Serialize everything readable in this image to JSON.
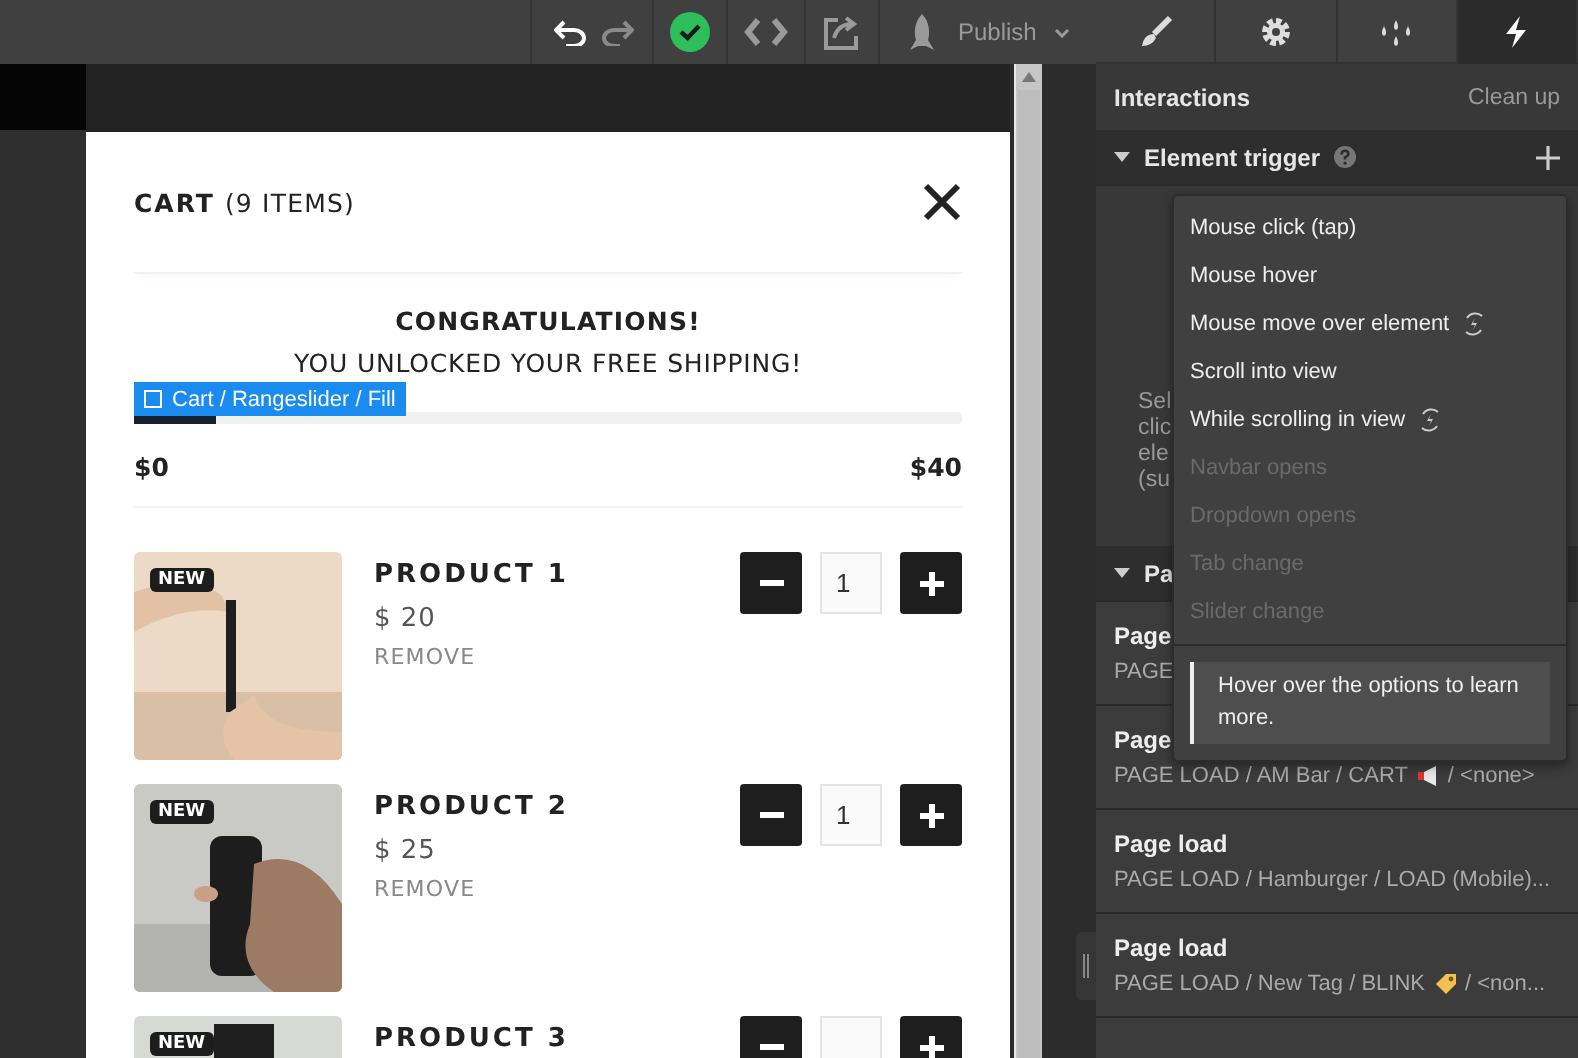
{
  "toolbar": {
    "buttons": [
      {
        "kind": "undo",
        "disabled": false
      },
      {
        "kind": "redo",
        "disabled": true
      },
      {
        "kind": "status"
      },
      {
        "kind": "code"
      },
      {
        "kind": "export"
      }
    ],
    "publish": "Publish"
  },
  "cart": {
    "title": "CART",
    "count": "(9 ITEMS)",
    "headline": "CONGRATULATIONS!",
    "message": "YOU UNLOCKED YOUR FREE SHIPPING!",
    "selection_label": "Cart / Rangeslider / Fill",
    "progress": {
      "level": 0.1
    },
    "min": "$0",
    "max": "$40",
    "products": [
      {
        "badge": "NEW",
        "name": "PRODUCT 1",
        "price": "$ 20",
        "remove": "REMOVE",
        "quantity": "1"
      },
      {
        "badge": "NEW",
        "name": "PRODUCT 2",
        "price": "$ 25",
        "remove": "REMOVE",
        "quantity": "1"
      },
      {
        "badge": "NEW",
        "name": "PRODUCT 3"
      }
    ]
  },
  "panel": {
    "tabs": [
      {
        "selected": false
      },
      {
        "selected": false
      },
      {
        "selected": false
      },
      {
        "selected": true
      }
    ],
    "title": "Interactions",
    "action": "Clean up",
    "element_trigger": {
      "title": "Element trigger",
      "expanded": true,
      "hint_lines": [
        "Sel",
        "clic",
        "ele",
        "(su"
      ]
    },
    "page_trigger": {
      "title": "Pa",
      "expanded": true,
      "items": [
        {
          "title": "Page",
          "path": "PAGE"
        },
        {
          "title": "Page",
          "path": "PAGE LOAD / AM Bar / CART",
          "kind": "megaphone",
          "tail": "/ <none>"
        },
        {
          "title": "Page load",
          "path": "PAGE LOAD / Hamburger / LOAD (Mobile)..."
        },
        {
          "title": "Page load",
          "path": "PAGE LOAD / New Tag / BLINK",
          "kind": "tag",
          "tail": "/ <non..."
        }
      ]
    },
    "menu": {
      "options": [
        {
          "label": "Mouse click (tap)",
          "kind": "plain",
          "disabled": false
        },
        {
          "label": "Mouse hover",
          "kind": "plain",
          "disabled": false
        },
        {
          "label": "Mouse move over element",
          "kind": "continuous",
          "disabled": false
        },
        {
          "label": "Scroll into view",
          "kind": "plain",
          "disabled": false
        },
        {
          "label": "While scrolling in view",
          "kind": "continuous",
          "disabled": false
        },
        {
          "label": "Navbar opens",
          "kind": "plain",
          "disabled": true
        },
        {
          "label": "Dropdown opens",
          "kind": "plain",
          "disabled": true
        },
        {
          "label": "Tab change",
          "kind": "plain",
          "disabled": true
        },
        {
          "label": "Slider change",
          "kind": "plain",
          "disabled": true
        }
      ],
      "note": "Hover over the options to learn more."
    }
  }
}
